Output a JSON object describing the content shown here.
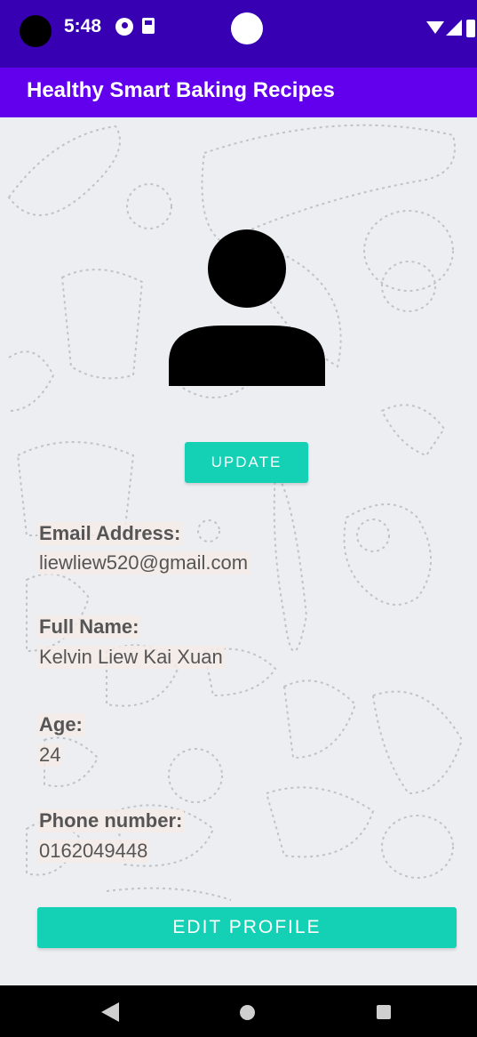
{
  "status_bar": {
    "time": "5:48",
    "icons": [
      "camera-hole",
      "data-saver-icon",
      "sd-card-icon",
      "wifi-icon",
      "signal-icon",
      "battery-icon"
    ]
  },
  "app_bar": {
    "title": "Healthy Smart Baking Recipes"
  },
  "profile": {
    "avatar_icon": "person-icon",
    "update_label": "UPDATE",
    "email_label": "Email Address:",
    "email_value": "liewliew520@gmail.com",
    "name_label": "Full Name:",
    "name_value": "Kelvin Liew Kai Xuan",
    "age_label": "Age:",
    "age_value": "24",
    "phone_label": "Phone number:",
    "phone_value": "0162049448",
    "edit_profile_label": "EDIT PROFILE"
  },
  "nav_bar": {
    "icons": [
      "back-icon",
      "home-icon",
      "recents-icon"
    ]
  },
  "colors": {
    "status_bar": "#3700b3",
    "app_bar": "#6200ee",
    "accent": "#14d1b6",
    "background": "#eceef2"
  }
}
